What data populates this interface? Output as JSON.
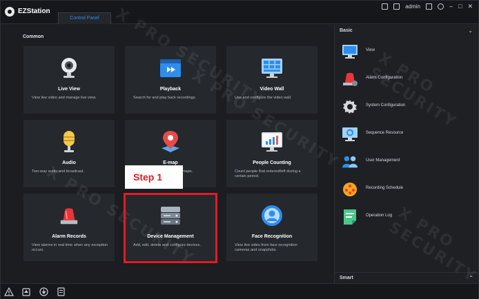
{
  "titlebar": {
    "app_title": "EZStation",
    "tab_label": "Control Panel",
    "user": "admin"
  },
  "main": {
    "section": "Common",
    "cards": [
      {
        "title": "Live View",
        "desc": "View live video and manage live view.",
        "icon": "camera-icon"
      },
      {
        "title": "Playback",
        "desc": "Search for and play back recordings.",
        "icon": "playback-icon"
      },
      {
        "title": "Video Wall",
        "desc": "Use and configure the video wall.",
        "icon": "video-wall-icon"
      },
      {
        "title": "Audio",
        "desc": "Two-way audio and broadcast.",
        "icon": "microphone-icon"
      },
      {
        "title": "E-map",
        "desc": "e-maps.",
        "icon": "map-pin-icon"
      },
      {
        "title": "People Counting",
        "desc": "Count people that entered/left during a certain period.",
        "icon": "people-counting-icon"
      },
      {
        "title": "Alarm Records",
        "desc": "View alarms in real time when any exception occurs.",
        "icon": "alarm-light-icon"
      },
      {
        "title": "Device Management",
        "desc": "Add, edit, delete and configure devices.",
        "icon": "server-icon"
      },
      {
        "title": "Face Recognition",
        "desc": "View live video from face recognition cameras and snapshots.",
        "icon": "face-recognition-icon"
      }
    ]
  },
  "side": {
    "header": "Basic",
    "items": [
      {
        "label": "View",
        "icon": "monitor-icon"
      },
      {
        "label": "Alarm Configuration",
        "icon": "alarm-config-icon"
      },
      {
        "label": "System Configuration",
        "icon": "gear-icon"
      },
      {
        "label": "Sequence Resource",
        "icon": "sequence-icon"
      },
      {
        "label": "User Management",
        "icon": "users-icon"
      },
      {
        "label": "Recording Schedule",
        "icon": "schedule-icon"
      },
      {
        "label": "Operation Log",
        "icon": "log-icon"
      }
    ],
    "footer": "Smart"
  },
  "annotation": {
    "step": "Step 1"
  },
  "watermark": "X PRO SECURITY",
  "colors": {
    "accent": "#2e8ded",
    "highlight": "#e31b23"
  }
}
